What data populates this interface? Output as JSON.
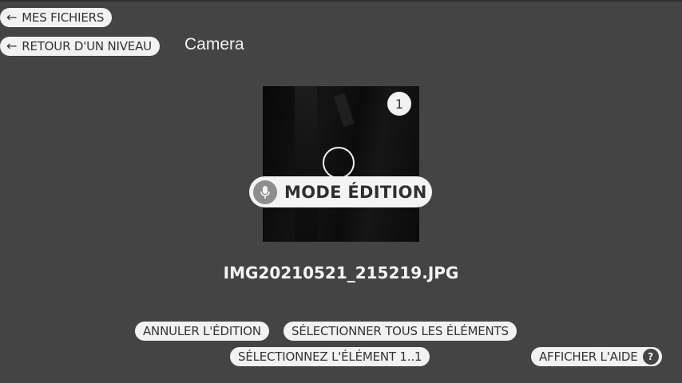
{
  "nav": {
    "my_files_label": "MES FICHIERS",
    "back_level_label": "RETOUR D'UN NIVEAU",
    "back_icon": "arrow-left-icon"
  },
  "folder": {
    "title": "Camera"
  },
  "file": {
    "selection_number": "1",
    "mode_label": "MODE ÉDITION",
    "mode_icon": "microphone-icon",
    "name": "IMG20210521_215219.JPG"
  },
  "actions": {
    "cancel_edit": "ANNULER L'ÉDITION",
    "select_all": "SÉLECTIONNER TOUS LES ÉLÉMENTS",
    "select_item": "SÉLECTIONNEZ L'ÉLÉMENT 1..1",
    "show_help": "AFFICHER L'AIDE",
    "help_icon_glyph": "?"
  },
  "colors": {
    "background": "#444444",
    "chip": "#f2f2f2",
    "text_light": "#f4f4f4"
  }
}
